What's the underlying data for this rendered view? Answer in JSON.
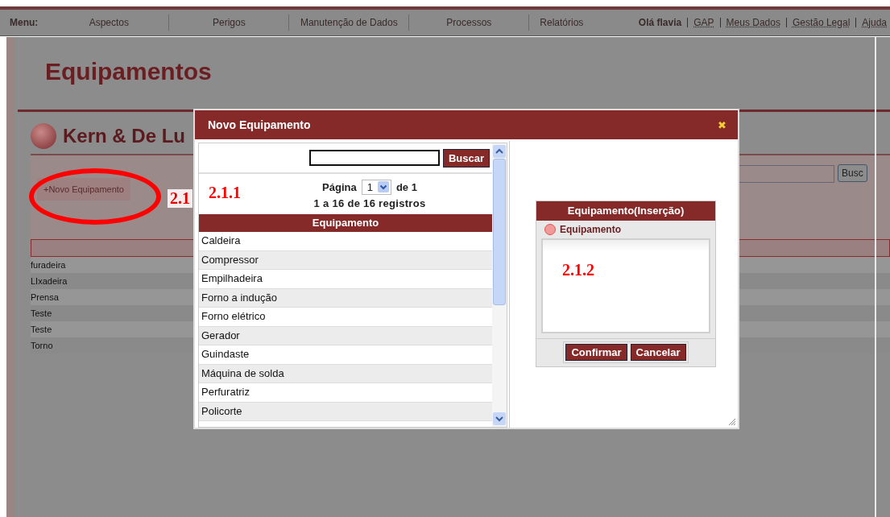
{
  "menu": {
    "label": "Menu:",
    "items": [
      "Aspectos",
      "Perigos",
      "Manutenção de Dados",
      "Processos",
      "Relatórios"
    ]
  },
  "user_links": {
    "greeting": "Olá flavia",
    "links": [
      "GAP",
      "Meus Dados",
      "Gestão Legal",
      "Ajuda"
    ]
  },
  "page": {
    "title": "Equipamentos",
    "company": "Kern & De Lu",
    "new_button": "+Novo Equipamento",
    "annotation": "2.1",
    "search_button": "Busc",
    "rows": [
      "furadeira",
      "LIxadeira",
      "Prensa",
      "Teste",
      "Teste",
      "Torno"
    ]
  },
  "dialog": {
    "title": "Novo Equipamento",
    "close": "✖",
    "list_panel": {
      "search_button": "Buscar",
      "page_label": "Página",
      "page_value": "1",
      "page_of": "de 1",
      "records": "1 a 16 de 16 registros",
      "annotation": "2.1.1",
      "column": "Equipamento",
      "rows": [
        "Caldeira",
        "Compressor",
        "Empilhadeira",
        "Forno a indução",
        "Forno elétrico",
        "Gerador",
        "Guindaste",
        "Máquina de solda",
        "Perfuratriz",
        "Policorte"
      ]
    },
    "form": {
      "title": "Equipamento(Inserção)",
      "field_label": "Equipamento",
      "annotation": "2.1.2",
      "buttons": [
        "Confirmar",
        "Cancelar"
      ]
    }
  }
}
